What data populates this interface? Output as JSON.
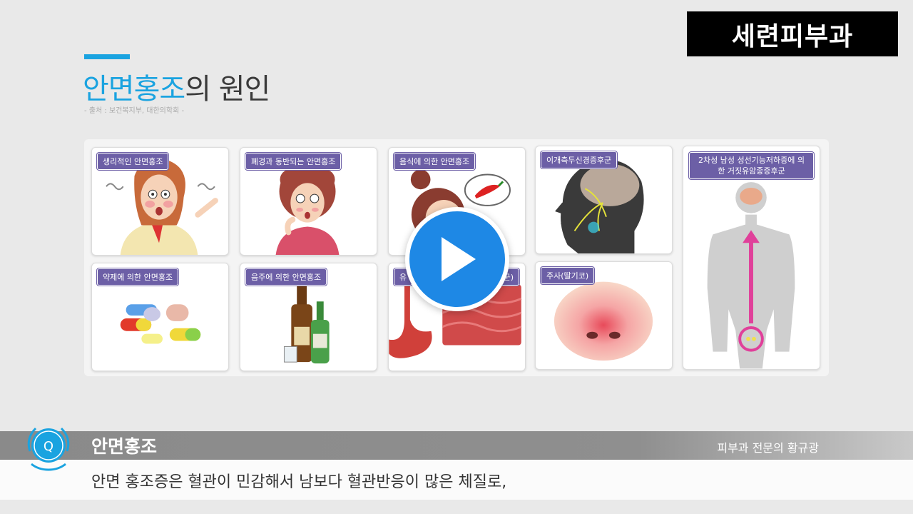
{
  "brand": "세련피부과",
  "slide": {
    "title_highlight": "안면홍조",
    "title_rest": "의 원인",
    "source": "- 출처 : 보건복지부, 대한의학회 -"
  },
  "cards": [
    {
      "label": "생리적인 안면홍조"
    },
    {
      "label": "폐경과 동반되는 안면홍조"
    },
    {
      "label": "음식에 의한 안면홍조"
    },
    {
      "label": "이개측두신경증후군"
    },
    {
      "label": "2차성 남성 성선기능저하증에 의한 거짓유암종증후군"
    },
    {
      "label": "약제에 의한 안면홍조"
    },
    {
      "label": "음주에 의한 안면홍조"
    },
    {
      "label": "유"
    },
    {
      "label": "주사(딸기코)"
    }
  ],
  "card8_tail": "군)",
  "player": {
    "play_icon": "play-icon"
  },
  "caption": {
    "badge": "Q",
    "name": "안면홍조",
    "role": "피부과 전문의 황규광",
    "line": "안면 홍조증은 혈관이 민감해서 남보다 혈관반응이 많은 체질로,"
  },
  "colors": {
    "accent": "#1aa3e0",
    "tag": "#6c5fa6",
    "play": "#1e88e5"
  }
}
